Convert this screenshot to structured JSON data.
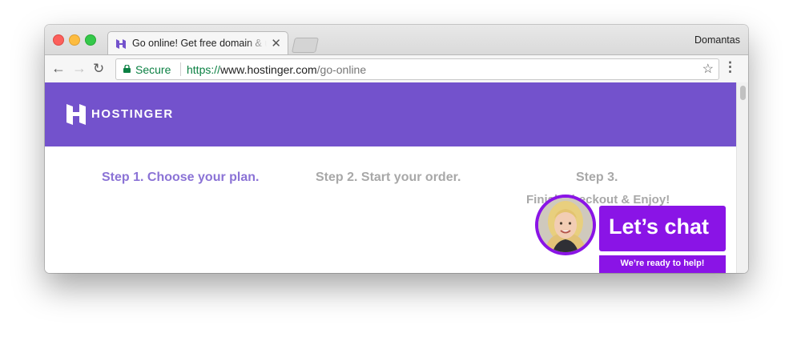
{
  "browser": {
    "tab_title": "Go online! Get free domain & unlimited hosting",
    "tab_close": "✕",
    "profile_name": "Domantas",
    "url_scheme": "https://",
    "url_host": "www.hostinger.com",
    "url_path": "/go-online",
    "secure_label": "Secure",
    "nav": {
      "back": "←",
      "forward": "→",
      "reload": "↻"
    },
    "star": "☆",
    "menu": "⋮"
  },
  "header": {
    "logo_text": "HOSTINGER",
    "background_color": "#7352cc"
  },
  "steps": [
    {
      "label": "Step 1.  Choose your plan."
    },
    {
      "label": "Step 2.  Start your order."
    },
    {
      "label": "Step 3.",
      "sub": "Finish checkout & Enjoy!"
    }
  ],
  "chat": {
    "title": "Let’s chat",
    "subtitle": "We’re ready to help!",
    "color": "#8a14e6"
  },
  "icons": {
    "favicon": "hostinger-favicon-icon",
    "lock": "lock-icon",
    "star": "bookmark-star-icon",
    "menu": "menu-dots-icon",
    "logo": "hostinger-logo-icon",
    "avatar": "agent-avatar"
  }
}
